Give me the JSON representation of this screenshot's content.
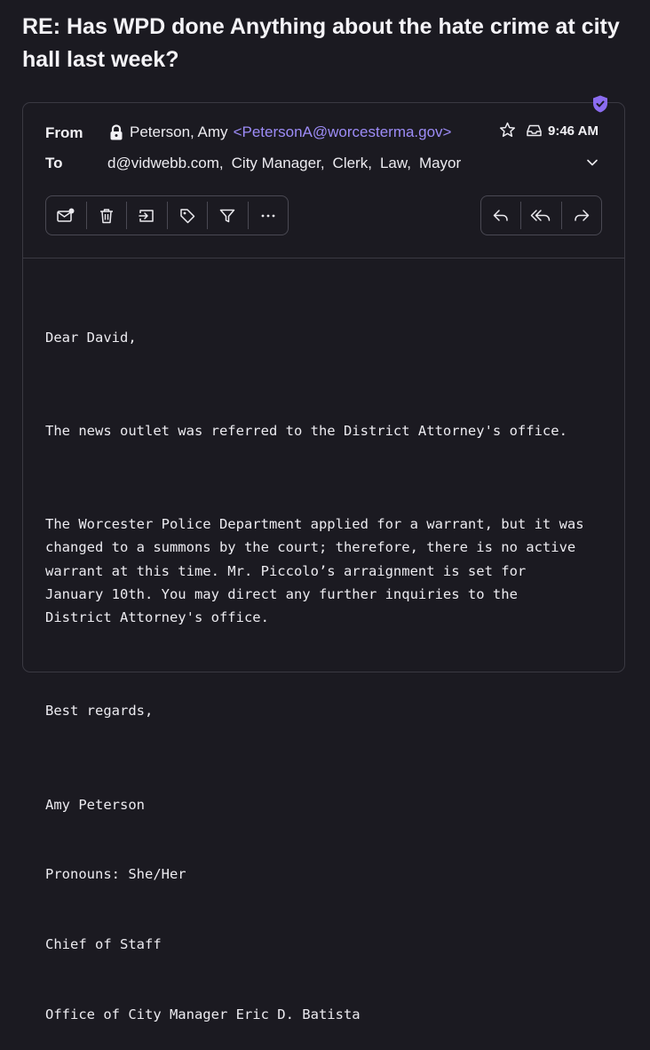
{
  "subject": "RE: Has WPD done Anything about the hate crime at city hall last week?",
  "header": {
    "from_label": "From",
    "to_label": "To",
    "sender_name": "Peterson, Amy",
    "sender_email": "<PetersonA@worcesterma.gov>",
    "time": "9:46 AM",
    "recipients": [
      "d@vidwebb.com,",
      "City Manager,",
      "Clerk,",
      "Law,",
      "Mayor"
    ]
  },
  "toolbar_left": [
    {
      "name": "mark-unread-icon"
    },
    {
      "name": "trash-icon"
    },
    {
      "name": "move-to-folder-icon"
    },
    {
      "name": "tag-icon"
    },
    {
      "name": "filter-icon"
    },
    {
      "name": "more-options-icon"
    }
  ],
  "toolbar_right": [
    {
      "name": "reply-icon"
    },
    {
      "name": "reply-all-icon"
    },
    {
      "name": "forward-icon"
    }
  ],
  "body": {
    "greeting": "Dear David,",
    "p1": "The news outlet was referred to the District Attorney's office.",
    "p2": "The Worcester Police Department applied for a warrant, but it was\nchanged to a summons by the court; therefore, there is no active\nwarrant at this time. Mr. Piccolo’s arraignment is set for\nJanuary 10th. You may direct any further inquiries to the\nDistrict Attorney's office.",
    "closing": "Best regards,",
    "signature": [
      "Amy Peterson",
      "Pronouns: She/Her",
      "Chief of Staff",
      "Office of City Manager Eric D. Batista"
    ]
  },
  "colors": {
    "background": "#1b1a21",
    "accent": "#9d8cf7",
    "shield": "#8b6cf0"
  }
}
